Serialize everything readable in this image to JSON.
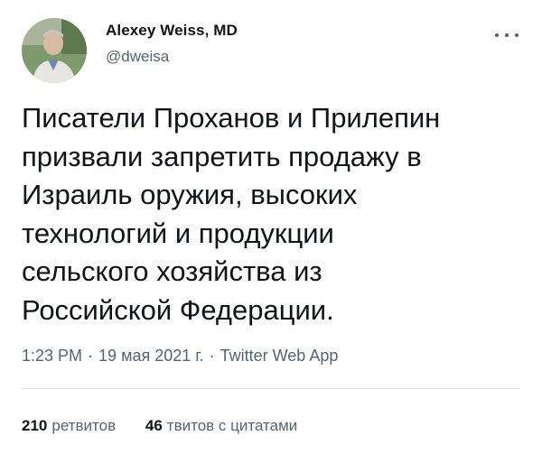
{
  "author": {
    "display_name": "Alexey Weiss, MD",
    "handle": "@dweisa"
  },
  "tweet": {
    "lines": [
      "Писатели Проханов и Прилепин",
      "призвали запретить продажу в",
      "Израиль оружия, высоких",
      "технологий и продукции",
      "сельского хозяйства из",
      "Российской Федерации."
    ],
    "time": "1:23 PM",
    "date": "19 мая 2021 г.",
    "source": "Twitter Web App",
    "separator": "·"
  },
  "stats": {
    "retweets_count": "210",
    "retweets_label": "ретвитов",
    "quotes_count": "46",
    "quotes_label": "твитов с цитатами"
  },
  "colors": {
    "text_primary": "#0f1419",
    "text_secondary": "#536471",
    "divider": "#e3e7ea"
  },
  "icons": {
    "more": "more-horizontal-icon"
  }
}
